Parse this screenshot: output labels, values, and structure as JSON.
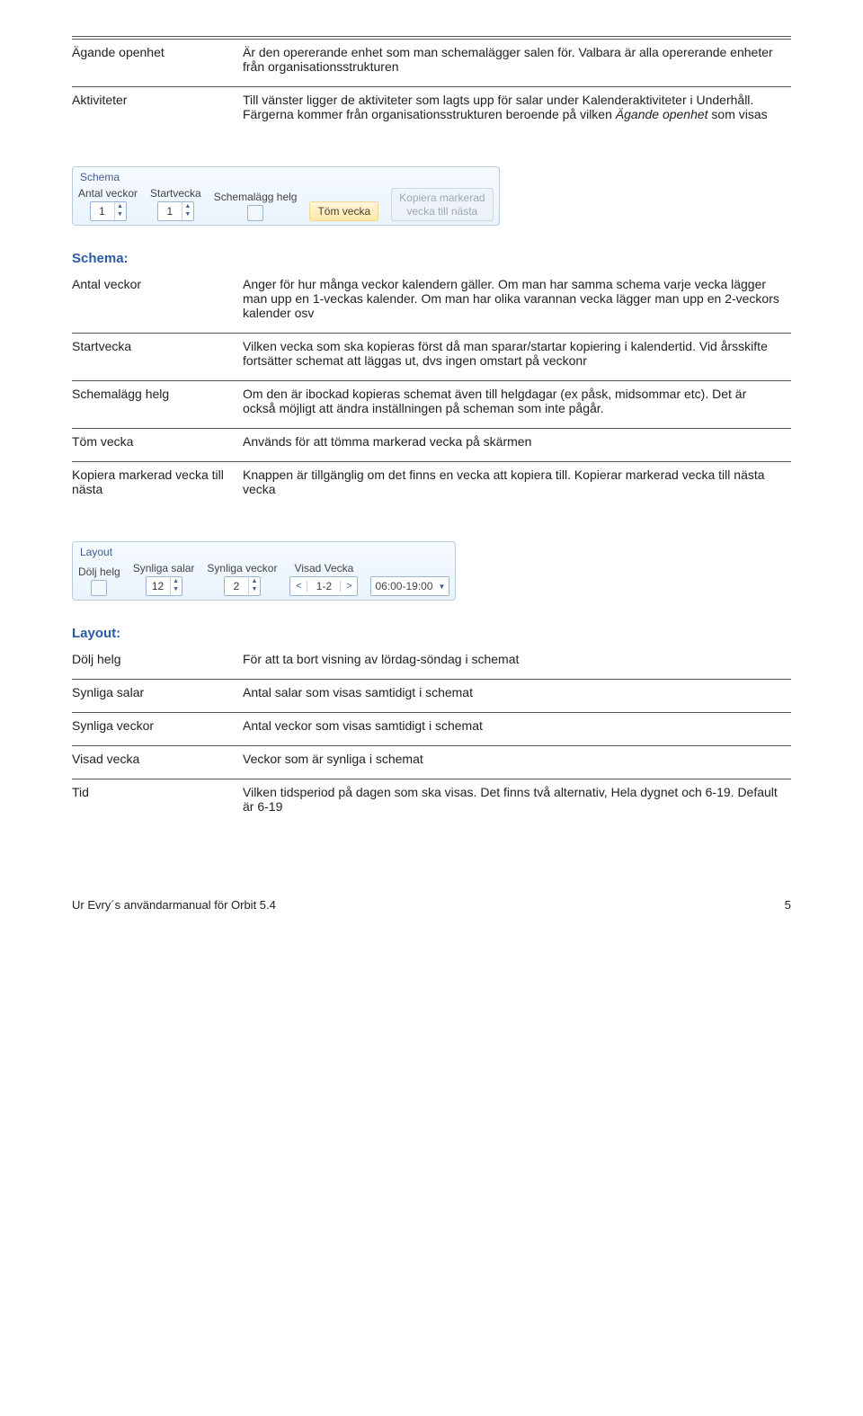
{
  "table1": {
    "r1": {
      "term": "Ägande openhet",
      "desc": "Är den opererande enhet som man schemalägger salen för. Valbara är alla opererande enheter från organisationsstrukturen"
    },
    "r2": {
      "term": "Aktiviteter",
      "desc_pre": "Till vänster ligger de aktiviteter som lagts upp för salar under Kalenderaktiviteter i Underhåll. Färgerna kommer från organisationsstrukturen beroende på vilken ",
      "desc_italic": "Ägande openhet",
      "desc_post": " som visas"
    }
  },
  "ribbon_schema": {
    "title": "Schema",
    "labels": {
      "antal_veckor": "Antal veckor",
      "startvecka": "Startvecka",
      "schemalagg_helg": "Schemalägg helg"
    },
    "values": {
      "antal_veckor": "1",
      "startvecka": "1"
    },
    "btn_tom": "Töm vecka",
    "btn_kopiera_l1": "Kopiera markerad",
    "btn_kopiera_l2": "vecka till nästa"
  },
  "schema_head": "Schema:",
  "table_schema": {
    "r1": {
      "term": "Antal veckor",
      "desc": "Anger för hur många veckor kalendern gäller. Om man har samma schema varje vecka lägger man upp en 1-veckas kalender. Om man har olika varannan vecka lägger man upp en 2-veckors kalender osv"
    },
    "r2": {
      "term": "Startvecka",
      "desc": "Vilken vecka som ska kopieras först då man sparar/startar kopiering i kalendertid. Vid årsskifte fortsätter schemat att läggas ut, dvs ingen omstart på veckonr"
    },
    "r3": {
      "term": "Schemalägg helg",
      "desc": "Om den är ibockad kopieras schemat även till helgdagar (ex påsk, midsommar etc). Det är också möjligt att ändra inställningen på scheman som inte pågår."
    },
    "r4": {
      "term": "Töm vecka",
      "desc": "Används för att tömma markerad vecka på skärmen"
    },
    "r5": {
      "term": "Kopiera markerad vecka till nästa",
      "desc": "Knappen är tillgänglig om det finns en vecka att kopiera till. Kopierar markerad vecka till nästa vecka"
    }
  },
  "ribbon_layout": {
    "title": "Layout",
    "labels": {
      "dolj_helg": "Dölj helg",
      "synliga_salar": "Synliga salar",
      "synliga_veckor": "Synliga veckor",
      "visad_vecka": "Visad Vecka"
    },
    "values": {
      "synliga_salar": "12",
      "synliga_veckor": "2",
      "visad_vecka": "1-2",
      "tid": "06:00-19:00"
    }
  },
  "layout_head": "Layout:",
  "table_layout": {
    "r1": {
      "term": "Dölj helg",
      "desc": "För att ta bort visning av lördag-söndag i schemat"
    },
    "r2": {
      "term": "Synliga salar",
      "desc": "Antal salar som visas samtidigt i schemat"
    },
    "r3": {
      "term": "Synliga veckor",
      "desc": "Antal veckor som visas samtidigt i schemat"
    },
    "r4": {
      "term": "Visad vecka",
      "desc": "Veckor som är synliga i schemat"
    },
    "r5": {
      "term": "Tid",
      "desc": "Vilken tidsperiod på dagen som ska visas. Det finns två alternativ, Hela dygnet och 6-19.  Default är 6-19"
    }
  },
  "footer": {
    "left": "Ur Evry´s användarmanual för Orbit 5.4",
    "right": "5"
  }
}
